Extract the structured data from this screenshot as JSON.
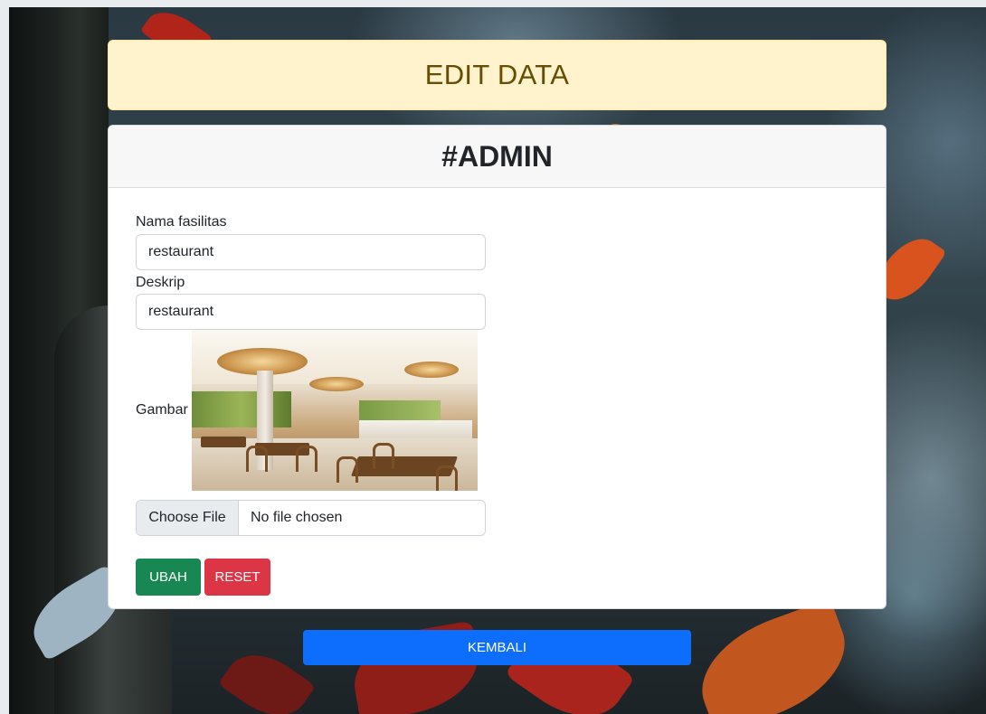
{
  "banner": {
    "title": "EDIT DATA"
  },
  "card": {
    "title": "#ADMIN",
    "fields": {
      "nama_label": "Nama fasilitas",
      "nama_value": "restaurant",
      "deskrip_label": "Deskrip",
      "deskrip_value": "restaurant",
      "gambar_label": "Gambar"
    },
    "file_input": {
      "button_label": "Choose File",
      "status": "No file chosen"
    },
    "buttons": {
      "ubah": "UBAH",
      "reset": "RESET"
    }
  },
  "footer": {
    "kembali": "KEMBALI"
  },
  "colors": {
    "banner_bg": "#fff3cd",
    "banner_text": "#664d03",
    "ubah": "#198754",
    "reset": "#dc3545",
    "kembali": "#0d6efd"
  },
  "icons": {
    "photo": "restaurant-photo"
  }
}
